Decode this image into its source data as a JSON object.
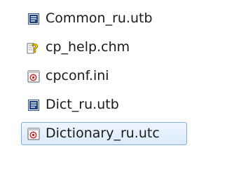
{
  "files": [
    {
      "name": "Common_ru.utb",
      "icon": "utb-file-icon",
      "selected": false
    },
    {
      "name": "cp_help.chm",
      "icon": "help-file-icon",
      "selected": false
    },
    {
      "name": "cpconf.ini",
      "icon": "ini-file-icon",
      "selected": false
    },
    {
      "name": "Dict_ru.utb",
      "icon": "utb-file-icon",
      "selected": false
    },
    {
      "name": "Dictionary_ru.utc",
      "icon": "utc-file-icon",
      "selected": true
    }
  ],
  "colors": {
    "selection_border": "#84acdd",
    "selection_fill": "#dcebfc",
    "text": "#1a1a1a"
  }
}
